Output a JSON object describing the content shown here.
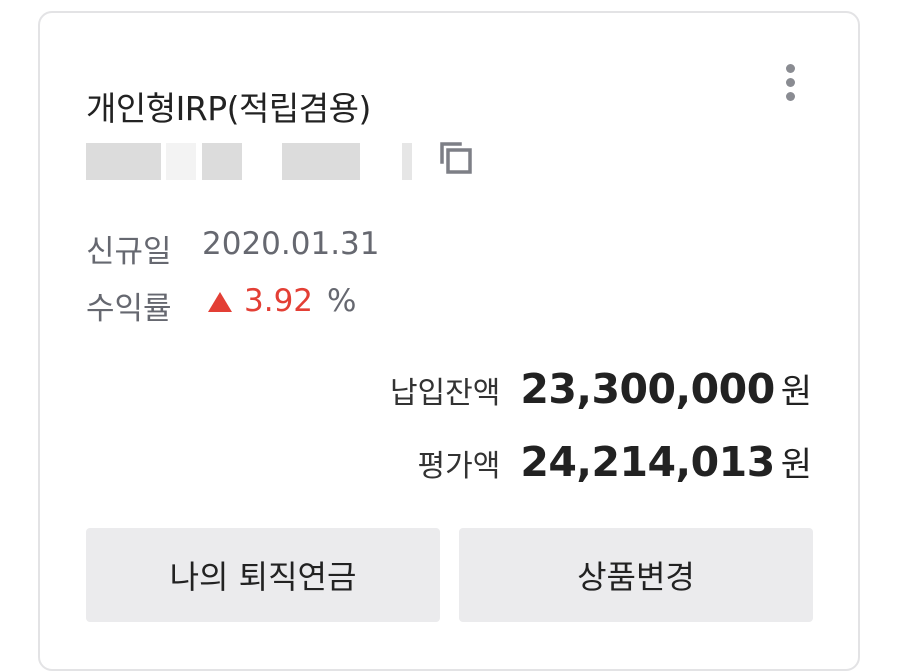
{
  "account": {
    "product_name": "개인형IRP(적립겸용)",
    "number_masked": true
  },
  "details": {
    "open_date_label": "신규일",
    "open_date": "2020.01.31",
    "return_label": "수익률",
    "return_direction": "up",
    "return_value": "3.92",
    "return_unit": "%",
    "up_color": "#e33f35"
  },
  "amounts": {
    "paid_label": "납입잔액",
    "paid_value": "23,300,000",
    "paid_unit": "원",
    "eval_label": "평가액",
    "eval_value": "24,214,013",
    "eval_unit": "원"
  },
  "actions": {
    "my_pension_label": "나의 퇴직연금",
    "change_product_label": "상품변경"
  },
  "icons": {
    "more": "more-vertical-icon",
    "copy": "copy-icon",
    "up": "triangle-up-icon"
  }
}
